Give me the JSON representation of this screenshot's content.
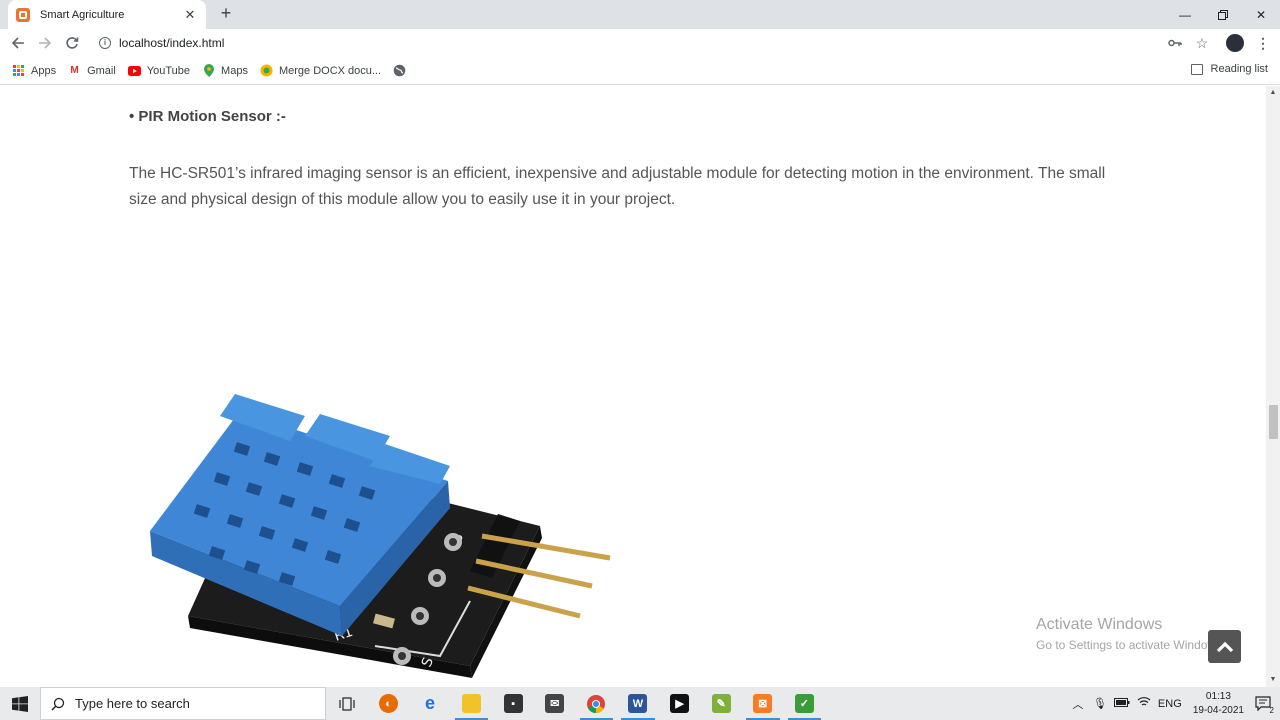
{
  "browser": {
    "tab_title": "Smart Agriculture",
    "url": "localhost/index.html",
    "bookmarks": [
      {
        "label": "Apps",
        "icon": "apps-grid-icon"
      },
      {
        "label": "Gmail",
        "icon": "gmail-icon"
      },
      {
        "label": "YouTube",
        "icon": "youtube-icon"
      },
      {
        "label": "Maps",
        "icon": "maps-icon"
      },
      {
        "label": "Merge DOCX docu...",
        "icon": "merge-docx-icon"
      }
    ],
    "reading_list": "Reading list"
  },
  "page": {
    "heading": "• PIR Motion Sensor :-",
    "paragraph": "The HC-SR501’s infrared imaging sensor is an efficient, inexpensive and adjustable module for detecting motion in the environment. The small size and physical design of this module allow you to easily use it in your project.",
    "image_alt": "sensor-module-image"
  },
  "watermark": {
    "line1": "Activate Windows",
    "line2": "Go to Settings to activate Windows."
  },
  "taskbar": {
    "search_placeholder": "Type here to search",
    "language": "ENG",
    "time": "01:13",
    "date": "19-04-2021",
    "notification_count": "2"
  },
  "colors": {
    "accent": "#3a8fd8",
    "sensor_blue": "#4a90d9",
    "pcb_black": "#1e1e1e"
  }
}
